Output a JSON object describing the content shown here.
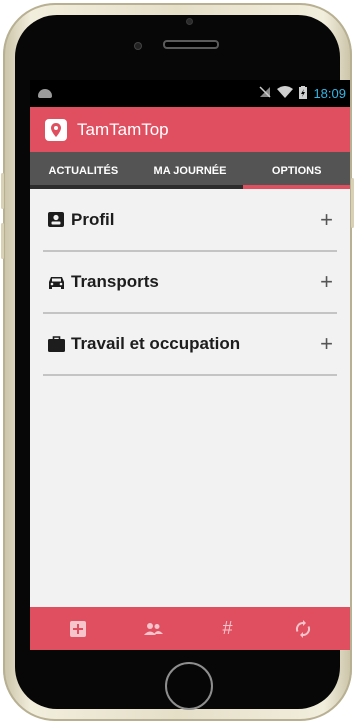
{
  "statusbar": {
    "time": "18:09",
    "icons": [
      "android-icon",
      "no-signal-icon",
      "wifi-icon",
      "battery-icon"
    ]
  },
  "app": {
    "title": "TamTamTop",
    "accent_color": "#e04f60",
    "logo_icon": "map-pin-icon"
  },
  "tabs": [
    {
      "label": "ACTUALITÉS",
      "active": false
    },
    {
      "label": "MA JOURNÉE",
      "active": false
    },
    {
      "label": "OPTIONS",
      "active": true
    }
  ],
  "options": [
    {
      "label": "Profil",
      "icon": "id-card-icon",
      "action": "+"
    },
    {
      "label": "Transports",
      "icon": "car-icon",
      "action": "+"
    },
    {
      "label": "Travail et occupation",
      "icon": "briefcase-icon",
      "action": "+"
    }
  ],
  "bottom_nav": [
    {
      "icon": "add-square-icon"
    },
    {
      "icon": "group-icon"
    },
    {
      "icon": "hashtag-icon",
      "label": "#"
    },
    {
      "icon": "sync-icon"
    }
  ]
}
